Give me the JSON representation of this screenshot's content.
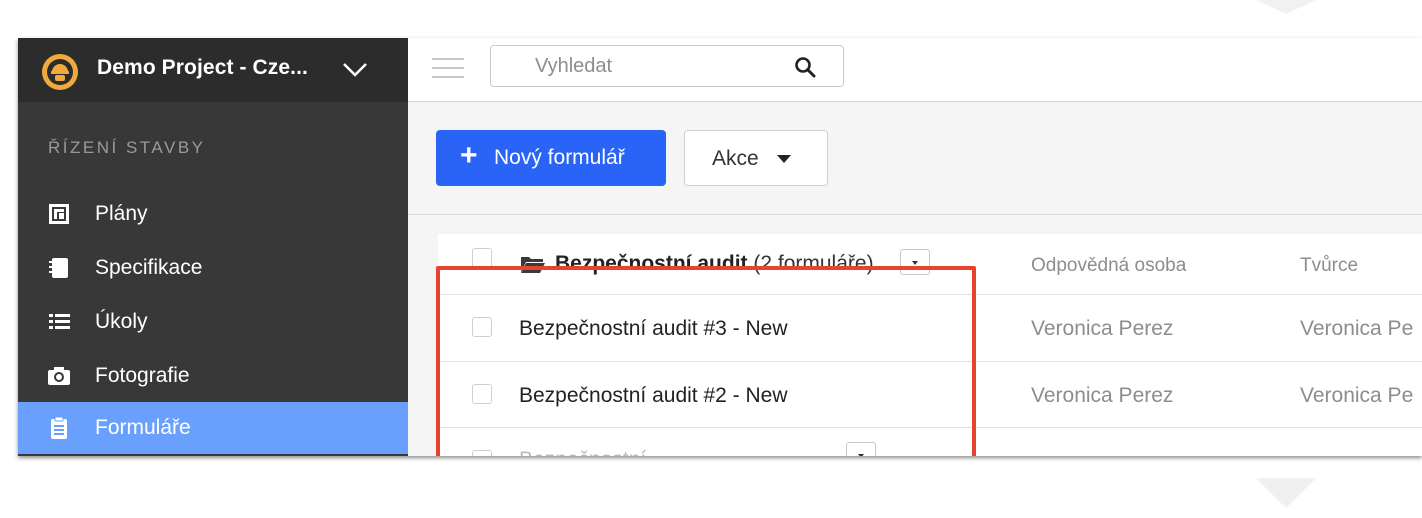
{
  "project": {
    "name": "Demo Project - Cze..."
  },
  "sidebar": {
    "section_title": "ŘÍZENÍ STAVBY",
    "items": [
      {
        "label": "Plány",
        "icon": "plans-icon"
      },
      {
        "label": "Specifikace",
        "icon": "specifications-icon"
      },
      {
        "label": "Úkoly",
        "icon": "list-icon"
      },
      {
        "label": "Fotografie",
        "icon": "camera-icon"
      },
      {
        "label": "Formuláře",
        "icon": "clipboard-icon",
        "active": true
      }
    ]
  },
  "search": {
    "placeholder": "Vyhledat"
  },
  "toolbar": {
    "new_label": "Nový formulář",
    "new_icon": "+",
    "actions_label": "Akce"
  },
  "table": {
    "group": {
      "name": "Bezpečnostní audit",
      "count_label": "(2 formuláře)"
    },
    "columns": {
      "responsible": "Odpovědná osoba",
      "creator": "Tvůrce"
    },
    "rows": [
      {
        "name": "Bezpečnostní audit #3 - New",
        "responsible": "Veronica Perez",
        "creator": "Veronica Pe"
      },
      {
        "name": "Bezpečnostní audit #2 - New",
        "responsible": "Veronica Perez",
        "creator": "Veronica Pe"
      }
    ],
    "partial_row": {
      "name": "Bezpečnostní"
    }
  },
  "colors": {
    "accent": "#2a64f6",
    "sidebar_active": "#6aa0fd",
    "highlight": "#e8432f",
    "sidebar_bg": "#383838"
  }
}
